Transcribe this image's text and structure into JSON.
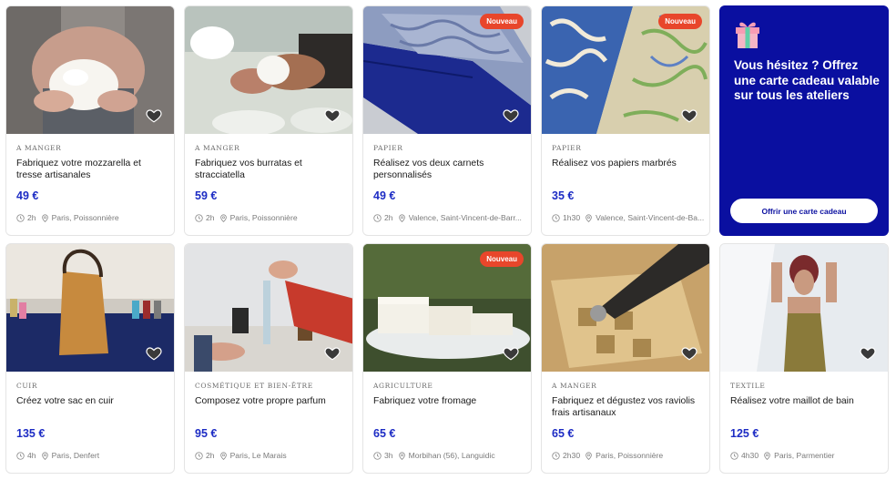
{
  "colors": {
    "accent": "#1d2cc4",
    "badge": "#e8462b",
    "gift_bg": "#0a0fa0"
  },
  "cards": [
    {
      "category": "A MANGER",
      "title": "Fabriquez votre mozzarella et tresse artisanales",
      "price": "49 €",
      "duration": "2h",
      "location": "Paris, Poissonnière",
      "badge": "",
      "image": "hands-holding-mozzarella"
    },
    {
      "category": "A MANGER",
      "title": "Fabriquez vos burratas et stracciatella",
      "price": "59 €",
      "duration": "2h",
      "location": "Paris, Poissonnière",
      "badge": "",
      "image": "hands-shaping-burrata"
    },
    {
      "category": "PAPIER",
      "title": "Réalisez vos deux carnets personnalisés",
      "price": "49 €",
      "duration": "2h",
      "location": "Valence, Saint-Vincent-de-Barr...",
      "badge": "Nouveau",
      "image": "blue-notebooks"
    },
    {
      "category": "PAPIER",
      "title": "Réalisez vos papiers marbrés",
      "price": "35 €",
      "duration": "1h30",
      "location": "Valence, Saint-Vincent-de-Ba...",
      "badge": "Nouveau",
      "image": "marbled-papers"
    },
    {
      "category": "CUIR",
      "title": "Créez votre sac en cuir",
      "price": "135 €",
      "duration": "4h",
      "location": "Paris, Denfert",
      "badge": "",
      "image": "leather-bag"
    },
    {
      "category": "COSMÉTIQUE ET BIEN-ÊTRE",
      "title": "Composez votre propre parfum",
      "price": "95 €",
      "duration": "2h",
      "location": "Paris, Le Marais",
      "badge": "",
      "image": "perfume-lab"
    },
    {
      "category": "AGRICULTURE",
      "title": "Fabriquez votre fromage",
      "price": "65 €",
      "duration": "3h",
      "location": "Morbihan (56), Languidic",
      "badge": "Nouveau",
      "image": "cheese-plate"
    },
    {
      "category": "A MANGER",
      "title": "Fabriquez et dégustez vos raviolis frais artisanaux",
      "price": "65 €",
      "duration": "2h30",
      "location": "Paris, Poissonnière",
      "badge": "",
      "image": "ravioli-cutter"
    },
    {
      "category": "TEXTILE",
      "title": "Réalisez votre maillot de bain",
      "price": "125 €",
      "duration": "4h30",
      "location": "Paris, Parmentier",
      "badge": "",
      "image": "swimsuit-model"
    }
  ],
  "gift": {
    "text": "Vous hésitez ? Offrez une carte cadeau valable sur tous les ateliers",
    "button": "Offrir une carte cadeau",
    "icon": "gift-icon"
  }
}
